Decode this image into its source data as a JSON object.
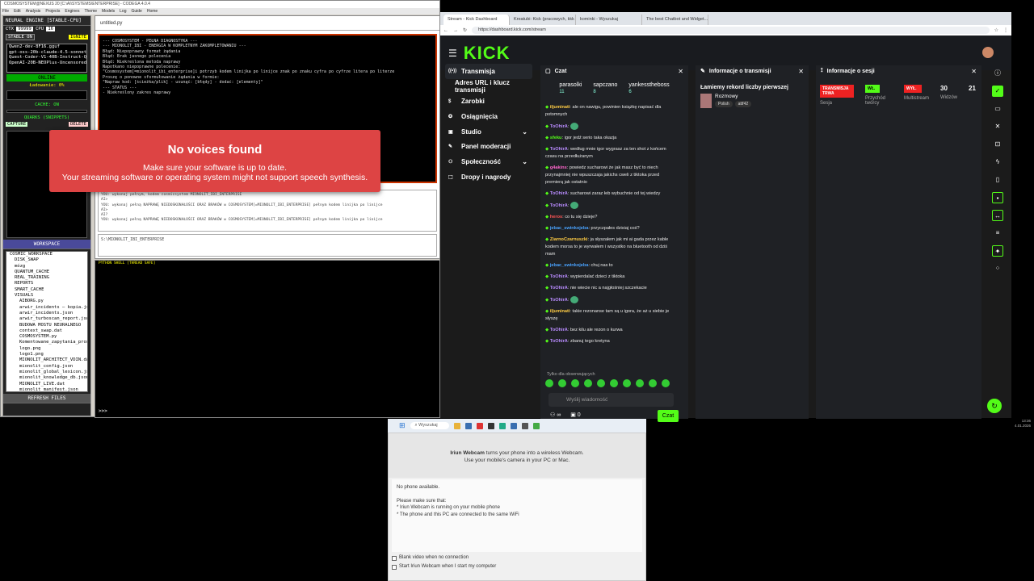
{
  "legacy": {
    "title": "COSMOSYSTEM@NEXUS 20 [C:\\AI\\SYSTEMS\\ENTERPRISE] - CODEGA 4.0.4",
    "menu": [
      "File",
      "Edit",
      "Analysis",
      "Projects",
      "Engines",
      "Theme",
      "Models",
      "Log",
      "Guide",
      "Home"
    ],
    "engine_header": "NEURAL ENGINE [STABLE-CPU]",
    "ctx_label": "CTX",
    "ctx_value": "99999",
    "cpu_label": "CPU",
    "cpu_value": "16",
    "stable_badge": "STABLE ON",
    "ignite_button": "IGNITE",
    "models": [
      "Qwen2-dev-8F16.gguf",
      "gpt-oss-20b-claude-4.5-sonnet-high-re",
      "Quest-Coder-V1-40B-Instruct-Q8_0.ggu",
      "OpenAI-20B-NEOPlus-Uncensored-Q8_0"
    ],
    "status_online": "ONLINE",
    "loading": "Ładowanie: 0%",
    "cache": "CACHE: ON",
    "quarks_header": "QUARKS (SNIPPETS)",
    "capture": "CAPTURE",
    "delete": "DELETE",
    "workspace": "WORKSPACE",
    "tree": [
      "COSMIC_WORKSPACE",
      "DISK_SWAP",
      "mózg",
      "QUANTUM_CACHE",
      "REAL_TRAINING",
      "REPORTS",
      "SMART_CACHE",
      "VISUALS",
      "AIBORG.py",
      "arwir_incidents — kopia.json",
      "arwir_incidents.json",
      "arwir_turboscan_report.json",
      "BUDOWA MOSTU NEURALNEGO",
      "context_swap.dat",
      "COSMOSYSTEM.py",
      "Komentowane_zapytania_prosb",
      "logo.png",
      "logo1.png",
      "MIONOLIT_ARCHITECT_VDIN.dat",
      "mionolit_config.json",
      "mionolit_global_lexicon.json",
      "mionolit_knowledge_db.json",
      "MIONOLIT_LIVE.dat",
      "mionolit_manifest.json"
    ],
    "refresh": "REFRESH FILES",
    "editor_tab": "untitled.py",
    "editor_lines": [
      "--- COSMOSYSTEM - PEŁNA DIAGNOSTYKA ---",
      "--- MIONOLIT_IBI - ENERGIA W KOMPLETNYM ZAKOMPLETOWANIU ---",
      "",
      "Błąd: Niepoprawny format żądania",
      "Błąd: Brak jasnego polecenia",
      "Błąd: Niekreślona metoda naprawy",
      "",
      "Napotkano niepoprawne polecenie:",
      "\"Cosmosystem[=mionolit_ibi_enterprise]i potrzyb kodem linijka po linijce znak po znaku cyfra po cyfrze litera po literze",
      "",
      "Proszę o ponowne sformułowanie żądania w formie:",
      "\"Napraw kod: [ścieżka/plik] - usunąć: [błędy] - dodać: [elementy]\"",
      "",
      "--- STATUS ---",
      "- Niekreślony zakres naprawy"
    ],
    "log_lines": [
      "YOU: wykonaj pełnym, kodem cosmicsystem MIONOLIT_IBI_ENTERPRISE",
      "AI>",
      "YOU: wykonaj pełną NAPRAWĘ NIEDOSKONAŁOŚCI ORAZ BRAKÓW w COSMOSYSTEM[=MIONOLIT_IBI_ENTERPRISE] pełnym kodem linijka po linijce",
      "AI>",
      "AI?",
      "YOU: wykonaj pełną NAPRAWĘ NIEDOSKONAŁOŚCI ORAZ BRAKÓW w COSMOSYSTEM[=MIONOLIT_IBI_ENTERPRISE] pełnym kodem linijka po linijce"
    ],
    "cmd": "S:\\MIONOLIT_IBI_ENTERPRISE",
    "console_head": "PYTHON SHELL [THREAD SAFE]",
    "prompt": ">>>"
  },
  "toast": {
    "title": "No voices found",
    "line1": "Make sure your software is up to date.",
    "line2": "Your streaming software or operating system might not support speech synthesis."
  },
  "browser": {
    "tabs": [
      "Stream - Kick Dashboard",
      "Kreatubi: Kick (pracowych, kkk i...",
      "kominki - Wyszukaj",
      "The best Chatbot and Widget..."
    ],
    "url": "https://dashboard.kick.com/stream",
    "logo": "KICK"
  },
  "kick": {
    "nav": [
      "Transmisja",
      "Adres URL i klucz transmisji",
      "Zarobki",
      "Osiągnięcia",
      "Studio",
      "Panel moderacji",
      "Społeczność",
      "Dropy i nagrody"
    ],
    "chat_title": "Czat",
    "pinned1_name": "parasolki",
    "pinned1_num": "11",
    "pinned2_name": "sapczano",
    "pinned2_num": "8",
    "pinned3_name": "yankesstheboss",
    "pinned3_num": "6",
    "messages": [
      {
        "user": "iljuminati",
        "text": "ale on nawigu, powinien książkę napisać dla potomnych",
        "cls": "o"
      },
      {
        "user": "ToOhirA",
        "text": ":",
        "cls": "p",
        "emote": true
      },
      {
        "user": "sfeku",
        "text": "igor jedź serio taka okazja",
        "cls": "g"
      },
      {
        "user": "ToOhirA",
        "text": "według mnie igor wygrasz za ten shot z końcem czasu na przedłużanym",
        "cls": "p"
      },
      {
        "user": "g4akins",
        "text": "powiedz sucharowi że jak masz być to niech przynajmniej nie wpuszczaja jakichs cweli z tiktoka przed premierą jak ostatnio",
        "cls": "c"
      },
      {
        "user": "ToOhirA",
        "text": "sucharowi zaraz łeb wybuchnie od tej wiedzy",
        "cls": "p"
      },
      {
        "user": "ToOhirA",
        "text": ":",
        "cls": "p",
        "emote": true
      },
      {
        "user": "heros",
        "text": "co tu się dzieje?",
        "cls": "r"
      },
      {
        "user": "jebac_swinkojeba",
        "text": "przyczpałes dzisiaj coś?",
        "cls": "bl"
      },
      {
        "user": "ZiarnoCzarnuszki",
        "text": "ja słyszałem jak mi ai gada przez kable kodem morsa to je wyrwałem i wszystko na bluetooth od dziś mam",
        "cls": "o"
      },
      {
        "user": "jebac_swinkojeba",
        "text": "chuj nas to",
        "cls": "bl"
      },
      {
        "user": "ToOhirA",
        "text": "wypierdalać dzieci z tiktoka",
        "cls": "p"
      },
      {
        "user": "ToOhirA",
        "text": "nie wiecie nic a najgłośniej szczekacie",
        "cls": "p"
      },
      {
        "user": "ToOhirA",
        "text": ":",
        "cls": "p",
        "emote": true
      },
      {
        "user": "iljuminati",
        "text": "takie rezonanse tam są u igora, że aż u siebie je słyszę",
        "cls": "o"
      },
      {
        "user": "ToOhirA",
        "text": "bez kilu ale rezon o kurwa",
        "cls": "p"
      },
      {
        "user": "ToOhirA",
        "text": "zbanuj tego kretyna",
        "cls": "p"
      }
    ],
    "followers_only": "Tylko dla obserwujących",
    "chat_placeholder": "Wyślij wiadomość",
    "chat_button": "Czat",
    "count_left": "∞",
    "count_right": "0",
    "tinfo_title": "Informacje o transmisji",
    "stream_title": "Łamiemy rekord liczby pierwszej",
    "category": "Rozmowy",
    "tag1": "Polish",
    "tag2": "attf42",
    "sinfo_title": "Informacje o sesji",
    "live_badge": "TRANSMISJA TRWA",
    "live_label": "Sesja",
    "rev_badge": "WŁ.",
    "rev_label": "Przychód twórcy",
    "multi_badge": "WYŁ.",
    "multi_label": "Multistream",
    "viewers": "30",
    "viewers_label": "Widzów",
    "extra": "21"
  },
  "iriun": {
    "title_bold": "Iriun Webcam",
    "title_rest": " turns your phone into a wireless Webcam.",
    "sub": "Use your mobile's camera in your PC or Mac.",
    "no_phone": "No phone available.",
    "make_sure": "Please make sure that:",
    "b1": "* Iriun Webcam is running on your mobile phone",
    "b2": "* The phone and this PC are connected to the same WiFi",
    "c1": "Blank video when no connection",
    "c2": "Start Iriun Webcam when I start my computer"
  },
  "taskbar": {
    "search": "Wyszukaj"
  },
  "tray": {
    "time": "13:36",
    "date": "4.01.2026"
  }
}
